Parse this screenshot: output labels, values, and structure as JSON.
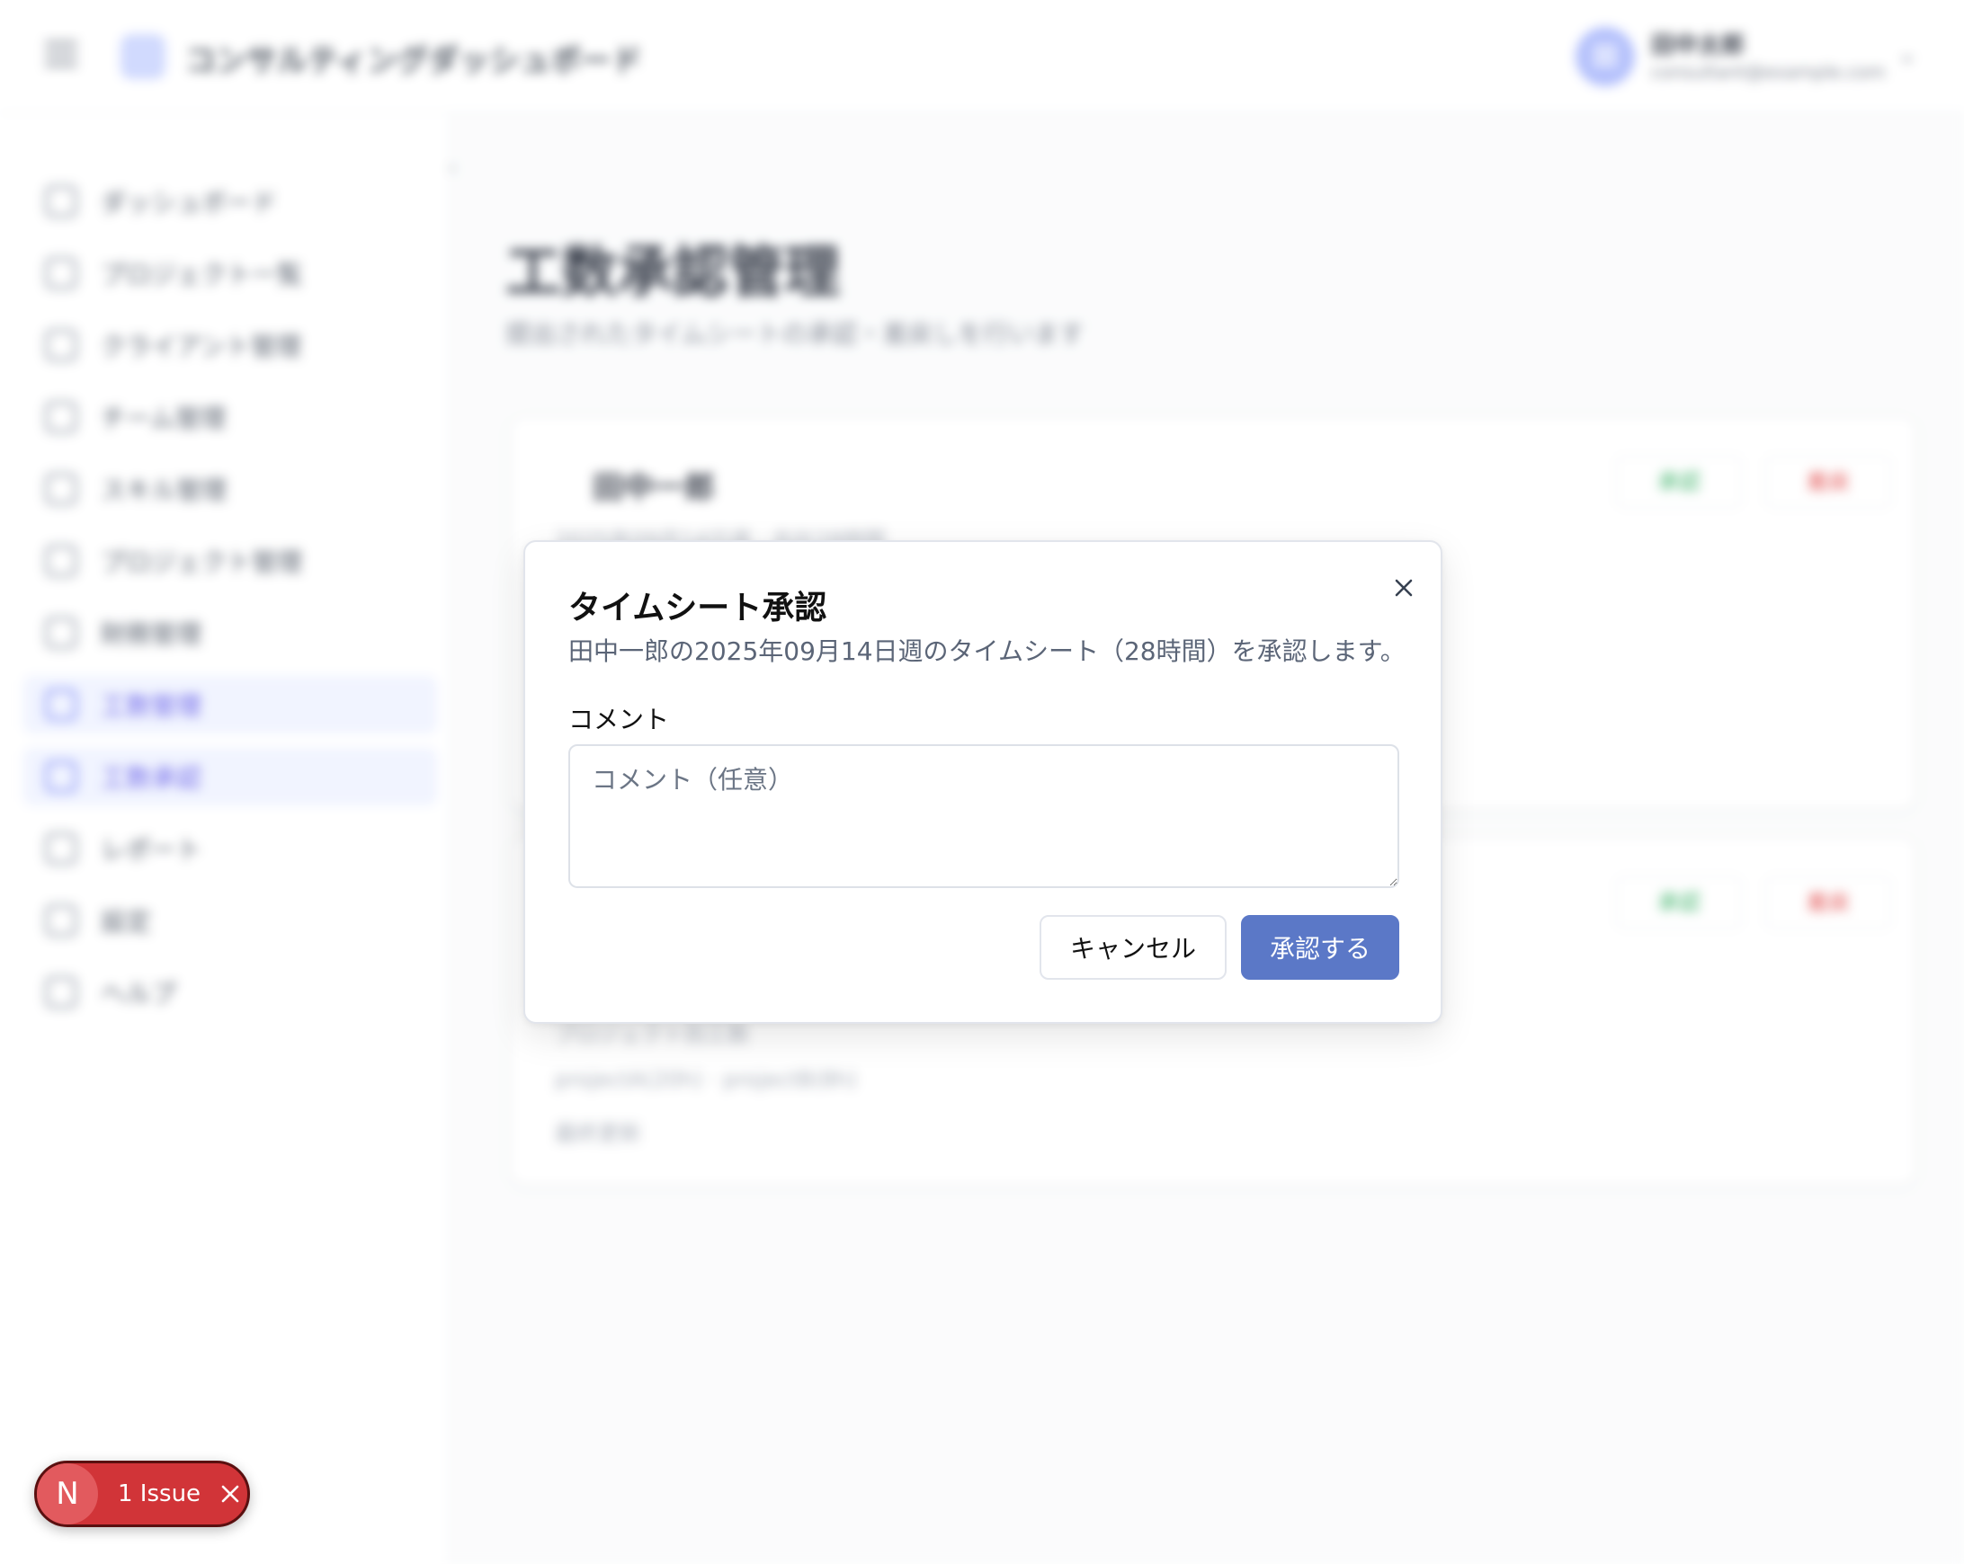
{
  "topbar": {
    "app_title": "コンサルティングダッシュボード",
    "user_initial": "田",
    "user_name": "田中太郎",
    "user_email": "consultant@example.com"
  },
  "sidebar": {
    "items": [
      {
        "label": "ダッシュボード"
      },
      {
        "label": "プロジェクト一覧"
      },
      {
        "label": "クライアント管理"
      },
      {
        "label": "チーム管理"
      },
      {
        "label": "スキル管理"
      },
      {
        "label": "プロジェクト管理"
      },
      {
        "label": "財務管理"
      },
      {
        "label": "工数管理"
      },
      {
        "label": "工数承認"
      },
      {
        "label": "レポート"
      },
      {
        "label": "設定"
      },
      {
        "label": "ヘルプ"
      }
    ]
  },
  "main": {
    "title": "工数承認管理",
    "subtitle": "提出されたタイムシートの承認・差戻しを行います",
    "cards": [
      {
        "title": "田中一郎",
        "meta": "2025年09月14日週 · 合計28時間",
        "approve": "承認",
        "reject": "差戻"
      },
      {
        "title": "",
        "meta": "",
        "approve": "承認",
        "reject": "差戻",
        "line1": "プロジェクト別工数",
        "line2": "projectA(20h) · projectB(8h)",
        "line3": "最終更新"
      }
    ]
  },
  "dialog": {
    "title": "タイムシート承認",
    "description": "田中一郎の2025年09月14日週のタイムシート（28時間）を承認します。",
    "comment_label": "コメント",
    "comment_placeholder": "コメント（任意）",
    "comment_value": "",
    "cancel_label": "キャンセル",
    "approve_label": "承認する",
    "accent_color": "#5b78c7"
  },
  "issue_badge": {
    "logo_letter": "N",
    "text": "1 Issue",
    "color": "#d13438"
  }
}
